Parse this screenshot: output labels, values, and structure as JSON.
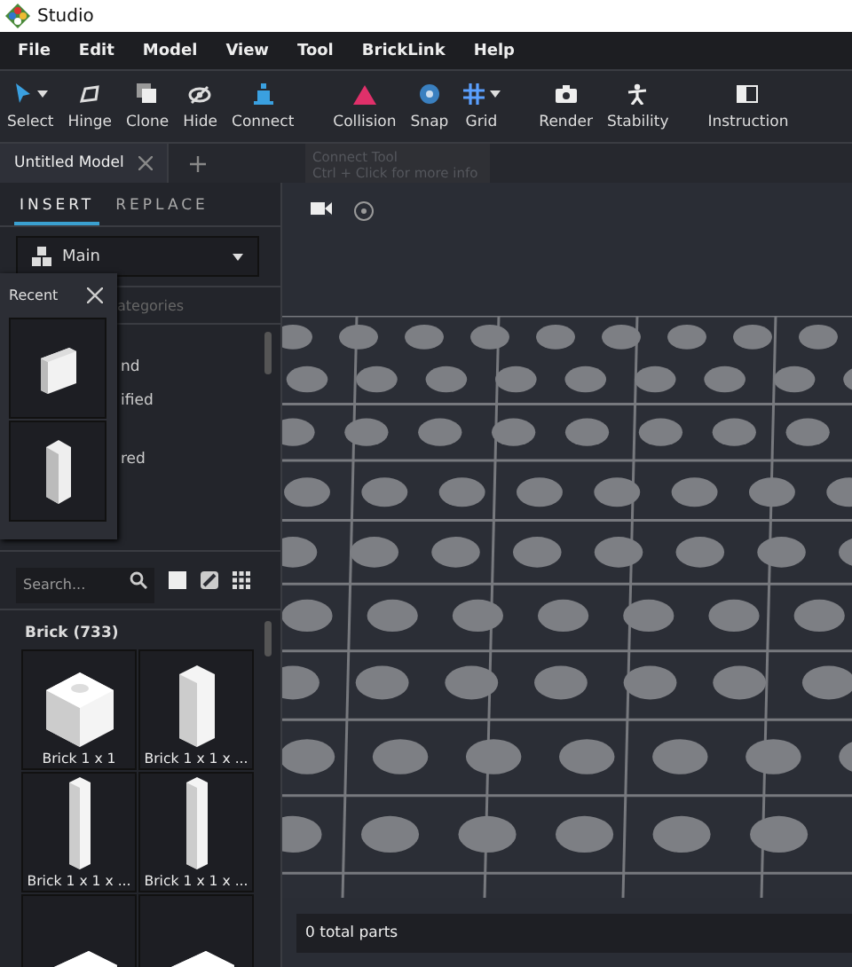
{
  "window": {
    "title": "Studio"
  },
  "menu": [
    "File",
    "Edit",
    "Model",
    "View",
    "Tool",
    "BrickLink",
    "Help"
  ],
  "toolbar": [
    {
      "label": "Select",
      "kind": "cursor",
      "dropdown": true
    },
    {
      "label": "Hinge",
      "kind": "hinge",
      "dropdown": false
    },
    {
      "label": "Clone",
      "kind": "clone",
      "dropdown": false
    },
    {
      "label": "Hide",
      "kind": "hide",
      "dropdown": false
    },
    {
      "label": "Connect",
      "kind": "connect",
      "dropdown": false
    },
    {
      "label": "Collision",
      "kind": "collision",
      "dropdown": false
    },
    {
      "label": "Snap",
      "kind": "snap",
      "dropdown": false
    },
    {
      "label": "Grid",
      "kind": "grid",
      "dropdown": true
    },
    {
      "label": "Render",
      "kind": "camera",
      "dropdown": false
    },
    {
      "label": "Stability",
      "kind": "stability",
      "dropdown": false
    },
    {
      "label": "Instruction",
      "kind": "instruction",
      "dropdown": false
    }
  ],
  "tooltip": {
    "title": "Connect Tool",
    "hint": "Ctrl + Click for more info"
  },
  "document_tabs": [
    {
      "label": "Untitled Model",
      "selected": true
    }
  ],
  "panel_tabs": [
    {
      "label": "INSERT",
      "selected": true
    },
    {
      "label": "REPLACE",
      "selected": false
    }
  ],
  "palette_dropdown": {
    "value": "Main"
  },
  "categories": {
    "header": "ategories",
    "items": [
      "nd",
      "ified",
      "red"
    ]
  },
  "recent": {
    "title": "Recent",
    "items": [
      {
        "kind": "plate"
      },
      {
        "kind": "tall"
      }
    ]
  },
  "search": {
    "placeholder": "Search..."
  },
  "group": {
    "title": "Brick (733)"
  },
  "parts": [
    {
      "label": "Brick 1 x 1",
      "kind": "cube"
    },
    {
      "label": "Brick 1 x 1 x ...",
      "kind": "tall"
    },
    {
      "label": "Brick 1 x 1 x ...",
      "kind": "thin"
    },
    {
      "label": "Brick 1 x 1 x ...",
      "kind": "thin"
    },
    {
      "kind": "wide"
    },
    {
      "kind": "wide"
    }
  ],
  "status_bar": {
    "text": "0 total parts"
  }
}
